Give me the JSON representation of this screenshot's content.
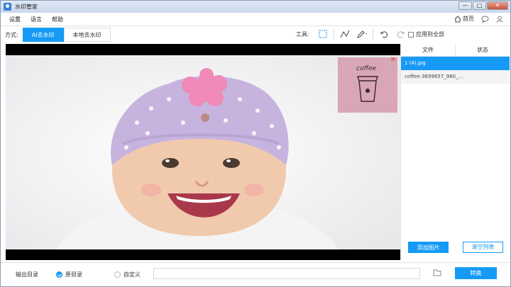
{
  "window": {
    "title": "水印管家",
    "controls": [
      "—",
      "□",
      "✕"
    ]
  },
  "menu": {
    "items": [
      "设置",
      "语言",
      "帮助"
    ],
    "home_label": "首页"
  },
  "toolbar": {
    "mode_label": "方式:",
    "tab_ai": "AI去水印",
    "tab_local": "本地去水印",
    "tools_label": "工具:",
    "apply_all_label": "应用到全部"
  },
  "watermark_overlay": {
    "text": "coffee",
    "background": "#d9a6b6"
  },
  "file_panel": {
    "col_file": "文件",
    "col_status": "状态",
    "files": [
      {
        "name": "1 (4).jpg",
        "selected": true
      },
      {
        "name": "coffee-3699657_960_...",
        "selected": false
      }
    ],
    "add_button": "添加图片",
    "clear_button": "清空列表"
  },
  "output": {
    "label": "输出目录",
    "option_original": "原目录",
    "option_custom": "自定义",
    "selected": "原目录",
    "path_value": "",
    "convert_button": "转换"
  },
  "colors": {
    "accent": "#169af5",
    "titlebar": "#c9d8ea",
    "canvas_bg": "#000000"
  }
}
